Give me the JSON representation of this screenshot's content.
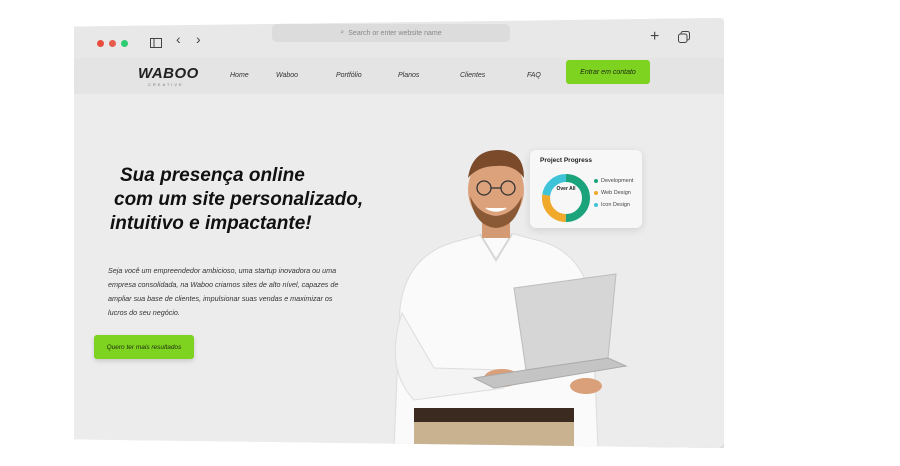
{
  "browser": {
    "url_placeholder": "Search or enter website name"
  },
  "nav": {
    "logo": "WABOO",
    "logo_sub": "CREATIVE",
    "items": [
      "Home",
      "Waboo",
      "Portfólio",
      "Planos",
      "Clientes",
      "FAQ"
    ],
    "cta": "Entrar em contato"
  },
  "hero": {
    "headline": [
      "Sua presença online",
      "com um site personalizado,",
      "intuitivo e impactante!"
    ],
    "paragraph": "Seja você um empreendedor ambicioso, uma startup inovadora ou uma empresa consolidada, na Waboo criamos sites de alto nível, capazes de ampliar sua base de clientes, impulsionar suas vendas e maximizar os lucros do seu negócio.",
    "button": "Quero ter mais resultados"
  },
  "progress_card": {
    "title": "Project Progress",
    "center_label": "Over All",
    "legend": [
      {
        "label": "Development",
        "color": "#1ba37c"
      },
      {
        "label": "Web Design",
        "color": "#f0a92a"
      },
      {
        "label": "Icon Design",
        "color": "#3ec3d8"
      }
    ]
  },
  "colors": {
    "accent": "#7ed321",
    "background": "#ececec"
  }
}
